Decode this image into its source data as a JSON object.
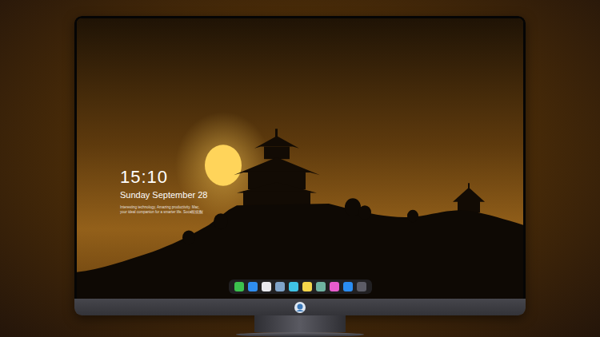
{
  "lock_screen": {
    "time": "15:10",
    "date": "Sunday September 28",
    "caption": [
      "Interesting technology, Amazing productivity. Mac,",
      "your ideal companion for a smarter life. Soca能提醒"
    ]
  },
  "dock": {
    "apps": [
      {
        "color": "#3cc24e"
      },
      {
        "color": "#2f8ef0"
      },
      {
        "color": "#e9e9ee"
      },
      {
        "color": "#7fa3c9"
      },
      {
        "color": "#3fc3e6"
      },
      {
        "color": "#f6d64a"
      },
      {
        "color": "#6fb3a2"
      },
      {
        "color": "#e85ccd"
      },
      {
        "color": "#2a8df2"
      },
      {
        "color": "#5c5c66"
      }
    ]
  }
}
